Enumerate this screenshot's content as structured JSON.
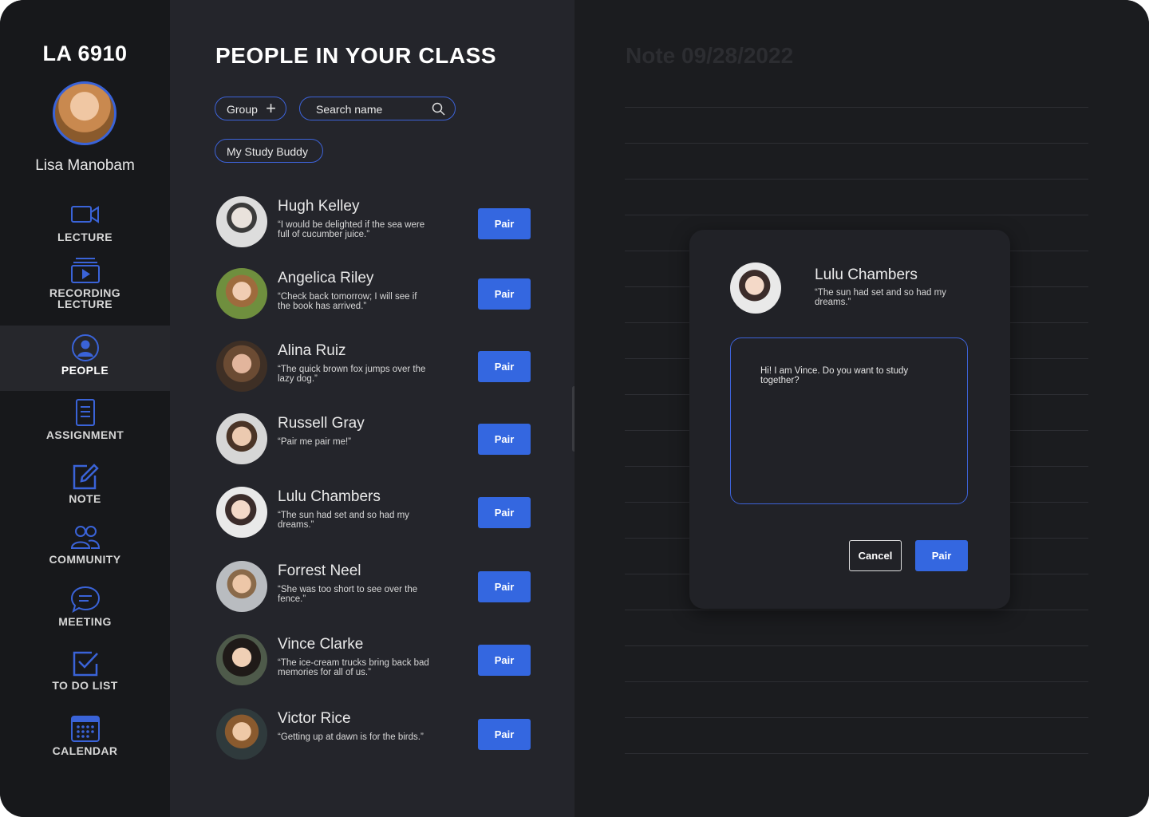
{
  "sidebar": {
    "course": "LA 6910",
    "user_name": "Lisa Manobam",
    "nav": [
      {
        "label": "LECTURE",
        "icon": "video-camera-icon"
      },
      {
        "label": "RECORDING LECTURE",
        "icon": "play-stack-icon"
      },
      {
        "label": "PEOPLE",
        "icon": "user-circle-icon",
        "active": true
      },
      {
        "label": "ASSIGNMENT",
        "icon": "document-icon"
      },
      {
        "label": "NOTE",
        "icon": "edit-note-icon"
      },
      {
        "label": "COMMUNITY",
        "icon": "users-icon"
      },
      {
        "label": "MEETING",
        "icon": "chat-bubble-icon"
      },
      {
        "label": "TO DO LIST",
        "icon": "checkbox-icon"
      },
      {
        "label": "CALENDAR",
        "icon": "calendar-icon"
      }
    ]
  },
  "people": {
    "title": "PEOPLE IN YOUR CLASS",
    "group_label": "Group",
    "search_placeholder": "Search name",
    "study_buddy_label": "My Study Buddy",
    "pair_label": "Pair",
    "list": [
      {
        "name": "Hugh Kelley",
        "quote": "“I would be delighted if the sea were full of cucumber juice.”"
      },
      {
        "name": "Angelica Riley",
        "quote": "“Check back tomorrow; I will see if the book has arrived.”"
      },
      {
        "name": "Alina Ruiz",
        "quote": "“The quick brown fox jumps over the lazy dog.”"
      },
      {
        "name": "Russell Gray",
        "quote": "“Pair me pair me!”"
      },
      {
        "name": "Lulu Chambers",
        "quote": "“The sun had set and so had my dreams.”"
      },
      {
        "name": "Forrest Neel",
        "quote": "“She was too short to see over the fence.”"
      },
      {
        "name": "Vince Clarke",
        "quote": "“The ice-cream trucks bring back bad memories for all of us.”"
      },
      {
        "name": "Victor Rice",
        "quote": "“Getting up at dawn is for the birds.”"
      }
    ]
  },
  "notes": {
    "title": "Note 09/28/2022"
  },
  "modal": {
    "name": "Lulu Chambers",
    "quote": "“The sun had set and so had my dreams.”",
    "message": "Hi! I am Vince. Do you want to study together?",
    "cancel_label": "Cancel",
    "pair_label": "Pair"
  },
  "colors": {
    "accent": "#3467e0",
    "panel": "#24252b",
    "sidebar": "#17181b",
    "background": "#1b1c1f"
  }
}
